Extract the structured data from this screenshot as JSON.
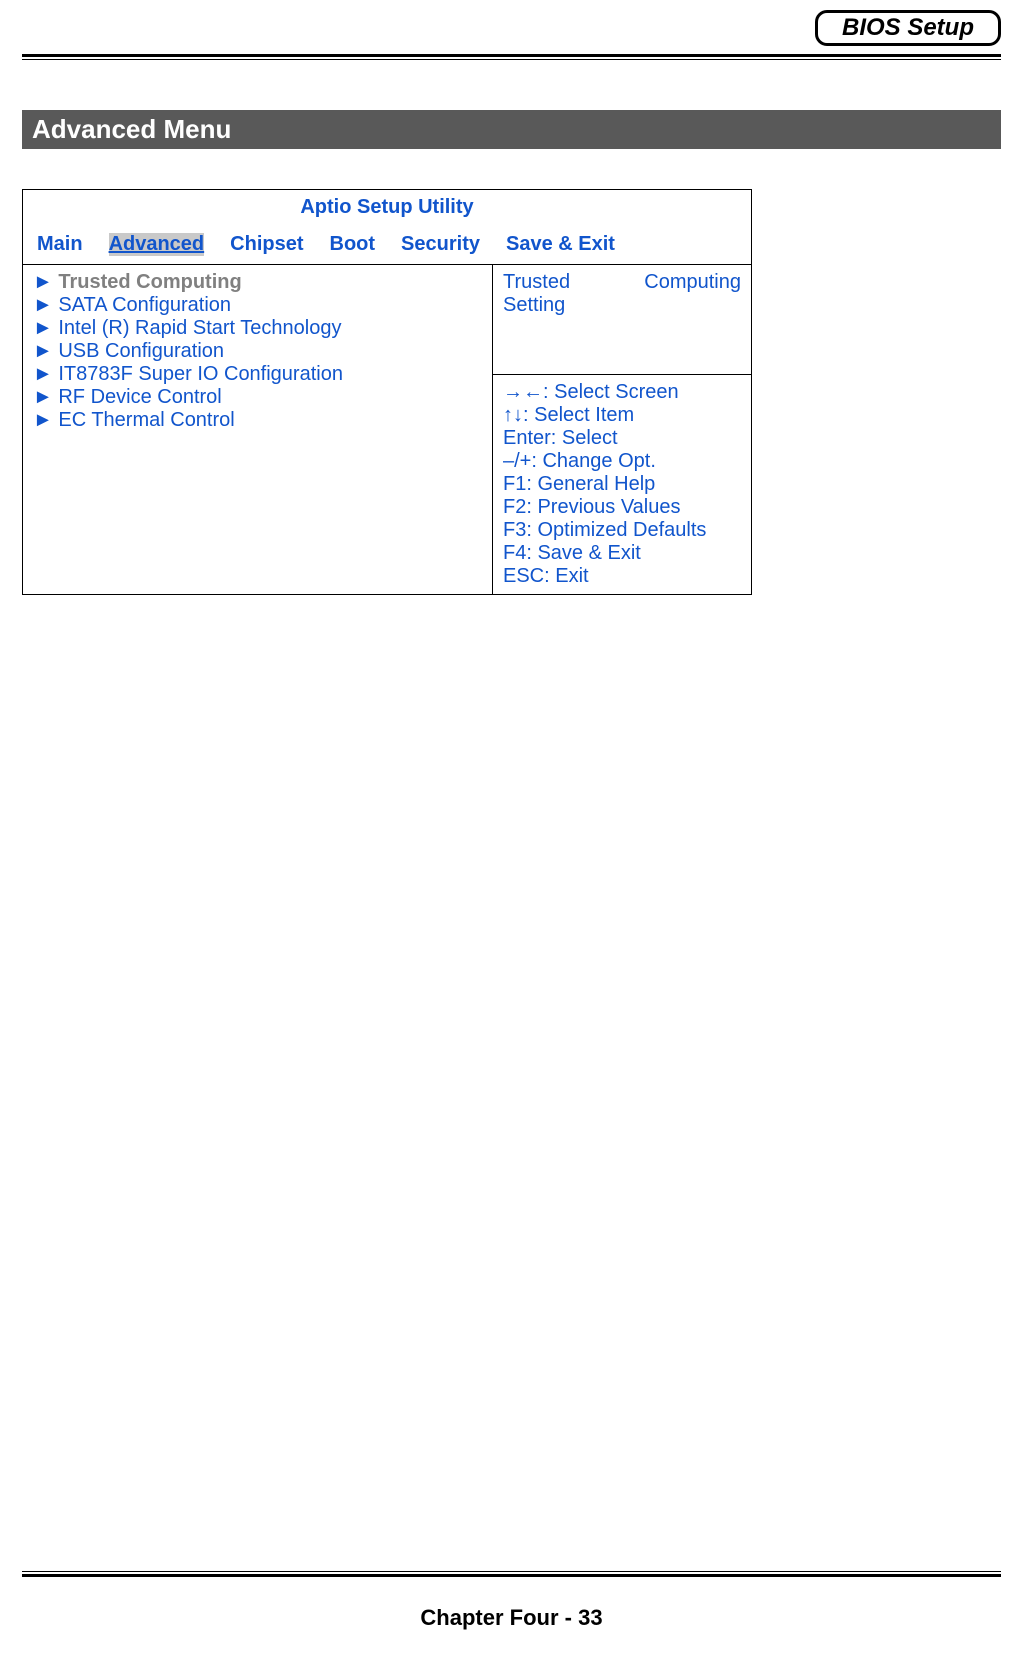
{
  "header": {
    "badge": "BIOS Setup"
  },
  "section_title": "Advanced Menu",
  "utility_title": "Aptio Setup Utility",
  "tabs": {
    "main": "Main",
    "advanced": "Advanced",
    "chipset": "Chipset",
    "boot": "Boot",
    "security": "Security",
    "save_exit": "Save & Exit"
  },
  "menu_items": {
    "i0": "Trusted Computing",
    "i1": "SATA Configuration",
    "i2": "Intel (R) Rapid Start Technology",
    "i3": "USB Configuration",
    "i4": "IT8783F Super IO Configuration",
    "i5": "RF Device Control",
    "i6": "EC Thermal Control"
  },
  "description": {
    "word1": "Trusted",
    "word2": "Computing",
    "line2": "Setting"
  },
  "help": {
    "h0": "→←: Select Screen",
    "h1": "↑↓: Select Item",
    "h2": "Enter: Select",
    "h3": "–/+: Change Opt.",
    "h4": "F1: General Help",
    "h5": "F2: Previous Values",
    "h6": "F3: Optimized Defaults",
    "h7": "F4: Save & Exit",
    "h8": "ESC: Exit"
  },
  "footer": "Chapter Four - 33"
}
